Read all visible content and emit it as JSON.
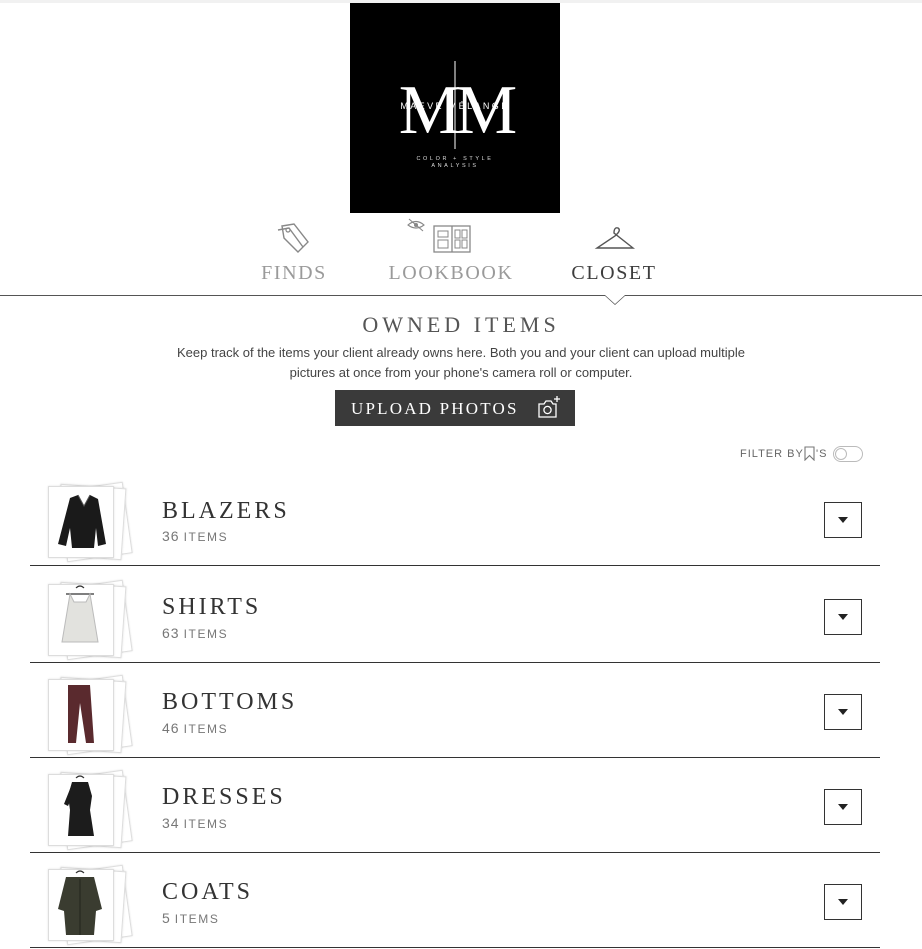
{
  "brand": {
    "monogram": "MM",
    "name": "MAEVE MÉLANGE",
    "tagline_line1": "COLOR + STYLE",
    "tagline_line2": "ANALYSIS"
  },
  "tabs": [
    {
      "label": "FINDS",
      "icon": "tag-icon",
      "active": false
    },
    {
      "label": "LOOKBOOK",
      "icon": "lookbook-icon",
      "active": false
    },
    {
      "label": "CLOSET",
      "icon": "hanger-icon",
      "active": true
    }
  ],
  "section": {
    "title": "OWNED ITEMS",
    "description": "Keep track of the items your client already owns here. Both you and your client can upload multiple pictures at once from your phone's camera roll or computer.",
    "upload_label": "UPLOAD PHOTOS"
  },
  "filter": {
    "label": "FILTER BY",
    "suffix": "'S",
    "enabled": false
  },
  "categories": [
    {
      "name": "BLAZERS",
      "count": "36",
      "count_label": "ITEMS",
      "thumb": "leather-jacket"
    },
    {
      "name": "SHIRTS",
      "count": "63",
      "count_label": "ITEMS",
      "thumb": "white-top"
    },
    {
      "name": "BOTTOMS",
      "count": "46",
      "count_label": "ITEMS",
      "thumb": "burgundy-pants"
    },
    {
      "name": "DRESSES",
      "count": "34",
      "count_label": "ITEMS",
      "thumb": "black-dress"
    },
    {
      "name": "COATS",
      "count": "5",
      "count_label": "ITEMS",
      "thumb": "olive-coat"
    }
  ],
  "colors": {
    "button_bg": "#3a3a3a",
    "text": "#444444",
    "tab_inactive": "#9a9a9a",
    "logo_bg": "#000000"
  }
}
